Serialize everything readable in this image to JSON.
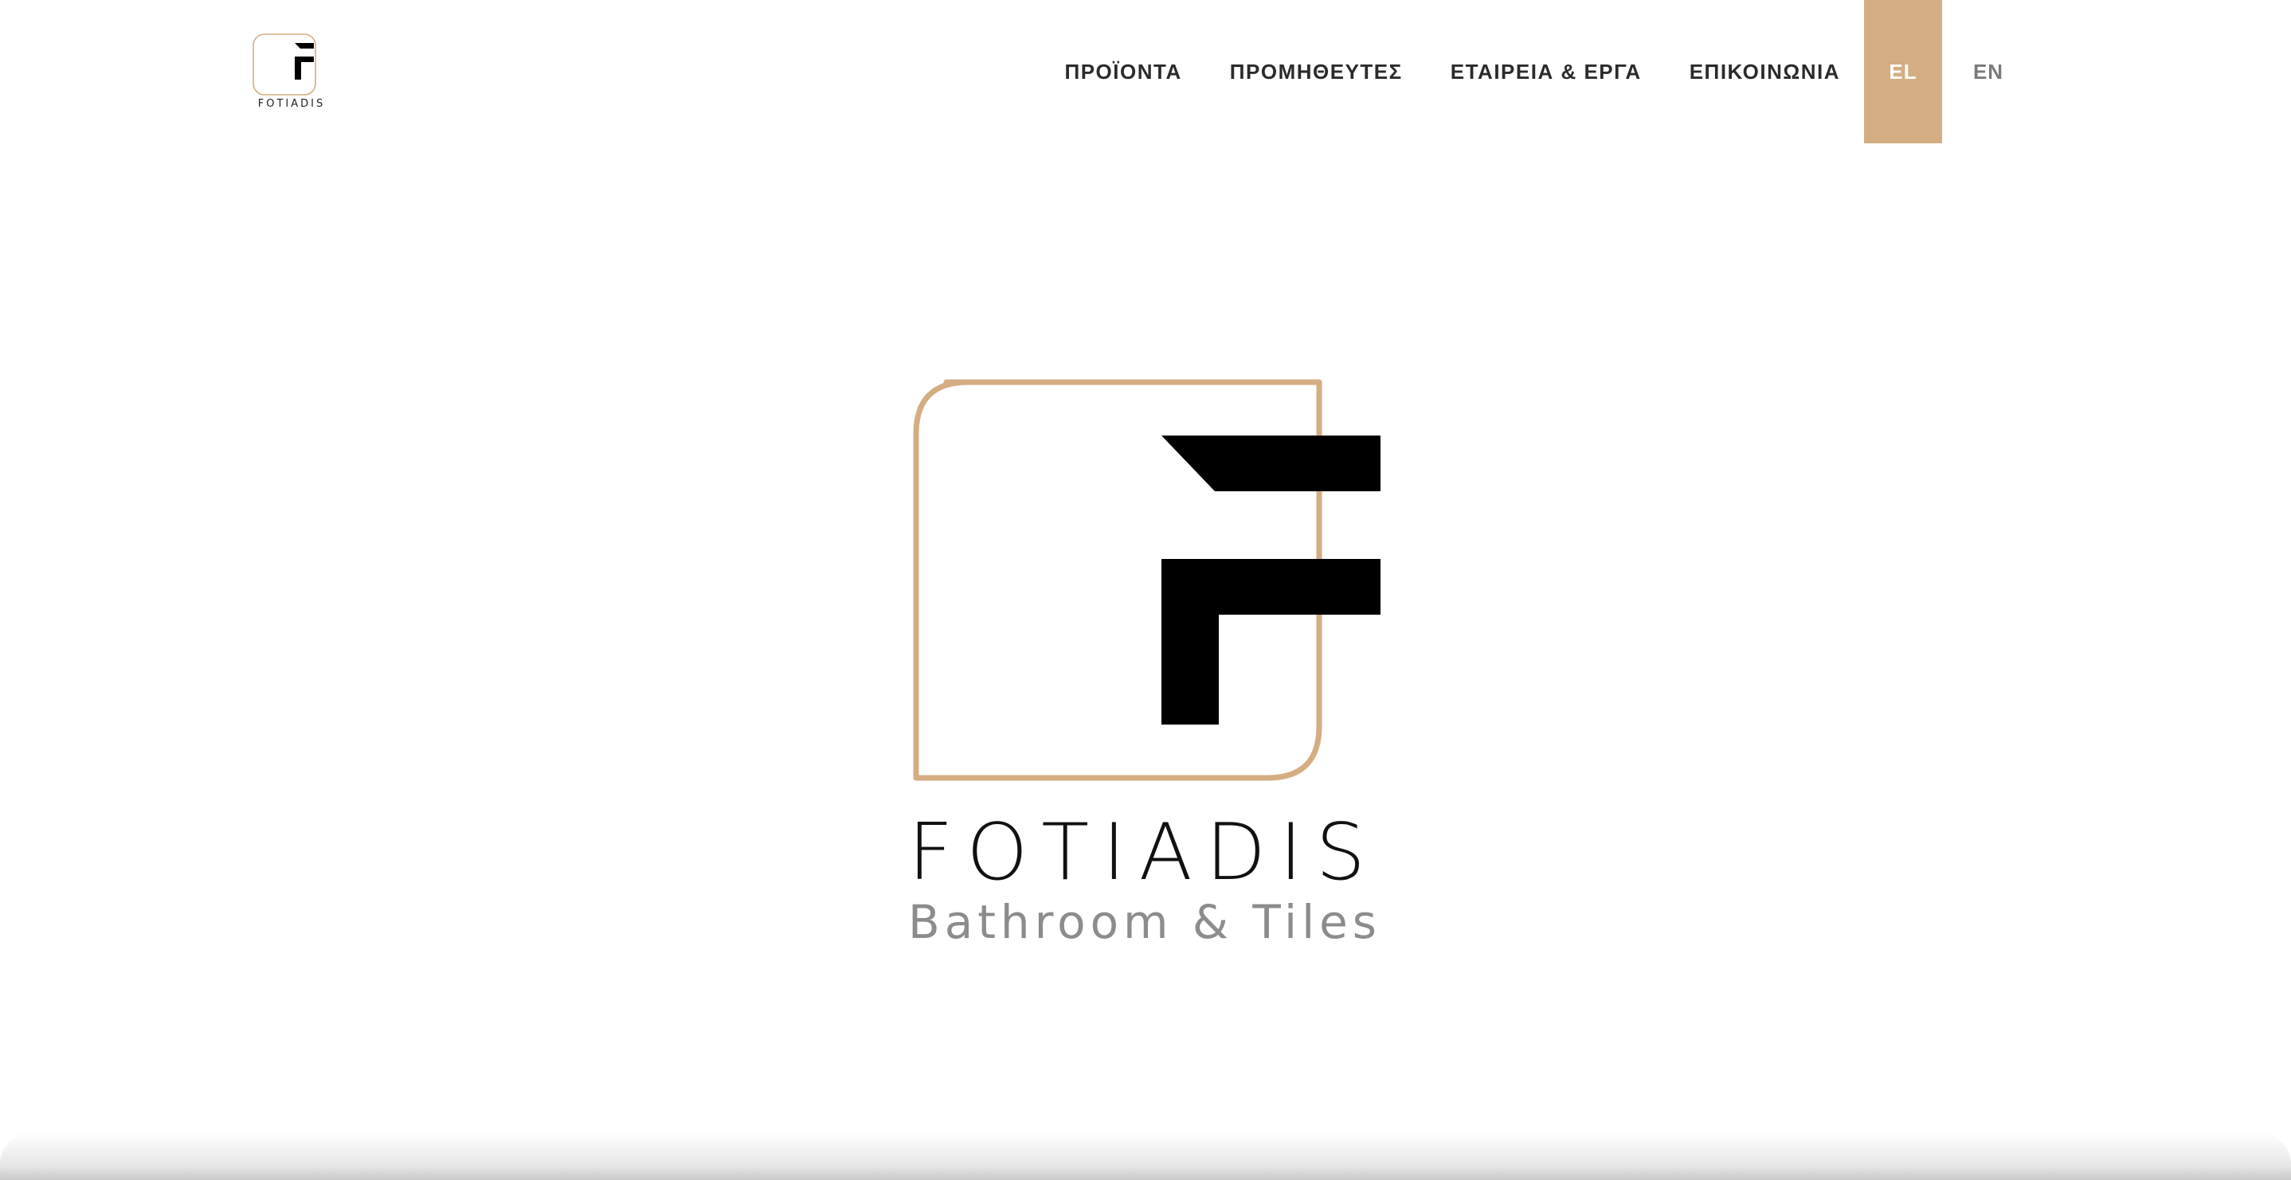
{
  "brand": {
    "name": "FOTIADIS",
    "tagline": "Bathroom & Tiles",
    "header_logo_icon": "fotiadis-logo-icon",
    "colors": {
      "accent": "#d4ad82",
      "dark": "#000000",
      "nav_text": "#2b2b2b",
      "tagline_gray": "#8c8c8c"
    }
  },
  "nav": {
    "items": [
      {
        "label": "ΠΡΟΪΟΝΤΑ"
      },
      {
        "label": "ΠΡΟΜΗΘΕΥΤΕΣ"
      },
      {
        "label": "ΕΤΑΙΡΕΙΑ & ΕΡΓΑ"
      },
      {
        "label": "ΕΠΙΚΟΙΝΩΝΙΑ"
      }
    ],
    "languages": {
      "active": "EL",
      "other": "EN"
    }
  }
}
